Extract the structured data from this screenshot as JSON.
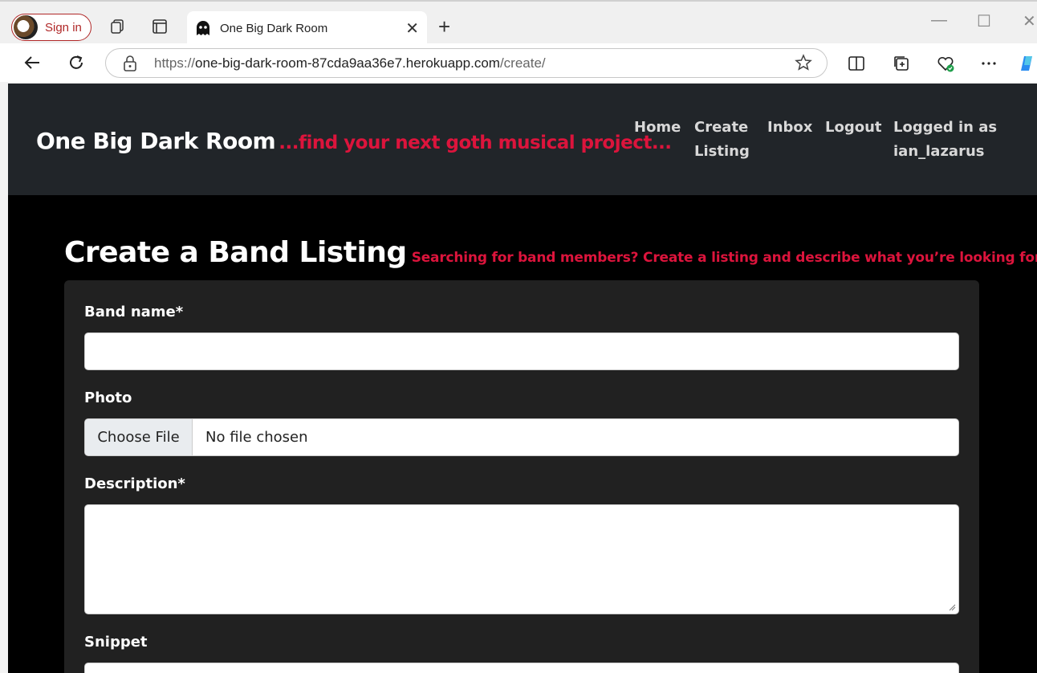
{
  "browser": {
    "signin_label": "Sign in",
    "tab_title": "One Big Dark Room",
    "url_prefix": "https://",
    "url_host": "one-big-dark-room-87cda9aa36e7.herokuapp.com",
    "url_path": "/create/"
  },
  "site": {
    "brand_name": "One Big Dark Room",
    "tagline": "...find your next goth musical project...",
    "nav": {
      "home": "Home",
      "create_1": "Create",
      "create_2": "Listing",
      "inbox": "Inbox",
      "logout": "Logout",
      "logged_in_1": "Logged in as",
      "logged_in_2": "ian_lazarus"
    },
    "accent_color": "#dc143c"
  },
  "form": {
    "heading": "Create a Band Listing",
    "subheading": "Searching for band members? Create a listing and describe what you’re looking for.",
    "band_name_label": "Band name*",
    "photo_label": "Photo",
    "choose_file": "Choose File",
    "no_file": "No file chosen",
    "description_label": "Description*",
    "snippet_label": "Snippet"
  }
}
